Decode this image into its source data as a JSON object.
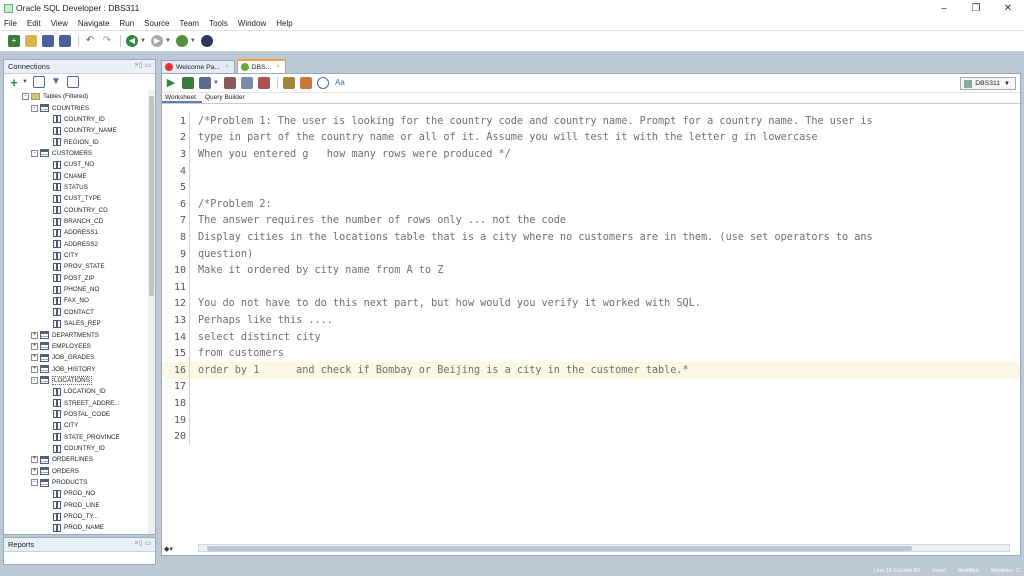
{
  "window": {
    "title": "Oracle SQL Developer : DBS311"
  },
  "menu": [
    "File",
    "Edit",
    "View",
    "Navigate",
    "Run",
    "Source",
    "Team",
    "Tools",
    "Window",
    "Help"
  ],
  "connections_panel": {
    "title": "Connections"
  },
  "tree": [
    {
      "label": "Tables (Filtered)",
      "kind": "folder",
      "level": 0,
      "expander": "-"
    },
    {
      "label": "COUNTRIES",
      "kind": "table",
      "level": 1,
      "expander": "-"
    },
    {
      "label": "COUNTRY_ID",
      "kind": "column",
      "level": 2
    },
    {
      "label": "COUNTRY_NAME",
      "kind": "column",
      "level": 2
    },
    {
      "label": "REGION_ID",
      "kind": "column",
      "level": 2
    },
    {
      "label": "CUSTOMERS",
      "kind": "table",
      "level": 1,
      "expander": "-"
    },
    {
      "label": "CUST_NO",
      "kind": "column",
      "level": 2
    },
    {
      "label": "CNAME",
      "kind": "column",
      "level": 2
    },
    {
      "label": "STATUS",
      "kind": "column",
      "level": 2
    },
    {
      "label": "CUST_TYPE",
      "kind": "column",
      "level": 2
    },
    {
      "label": "COUNTRY_CD",
      "kind": "column",
      "level": 2
    },
    {
      "label": "BRANCH_CD",
      "kind": "column",
      "level": 2
    },
    {
      "label": "ADDRESS1",
      "kind": "column",
      "level": 2
    },
    {
      "label": "ADDRESS2",
      "kind": "column",
      "level": 2
    },
    {
      "label": "CITY",
      "kind": "column",
      "level": 2
    },
    {
      "label": "PROV_STATE",
      "kind": "column",
      "level": 2
    },
    {
      "label": "POST_ZIP",
      "kind": "column",
      "level": 2
    },
    {
      "label": "PHONE_NO",
      "kind": "column",
      "level": 2
    },
    {
      "label": "FAX_NO",
      "kind": "column",
      "level": 2
    },
    {
      "label": "CONTACT",
      "kind": "column",
      "level": 2
    },
    {
      "label": "SALES_REP",
      "kind": "column",
      "level": 2
    },
    {
      "label": "DEPARTMENTS",
      "kind": "table",
      "level": 1,
      "expander": "+"
    },
    {
      "label": "EMPLOYEES",
      "kind": "table",
      "level": 1,
      "expander": "+"
    },
    {
      "label": "JOB_GRADES",
      "kind": "table",
      "level": 1,
      "expander": "+"
    },
    {
      "label": "JOB_HISTORY",
      "kind": "table",
      "level": 1,
      "expander": "+"
    },
    {
      "label": "LOCATIONS",
      "kind": "table",
      "level": 1,
      "expander": "-",
      "selected": true
    },
    {
      "label": "LOCATION_ID",
      "kind": "column",
      "level": 2
    },
    {
      "label": "STREET_ADDRE...",
      "kind": "column",
      "level": 2
    },
    {
      "label": "POSTAL_CODE",
      "kind": "column",
      "level": 2
    },
    {
      "label": "CITY",
      "kind": "column",
      "level": 2
    },
    {
      "label": "STATE_PROVINCE",
      "kind": "column",
      "level": 2
    },
    {
      "label": "COUNTRY_ID",
      "kind": "column",
      "level": 2
    },
    {
      "label": "ORDERLINES",
      "kind": "table",
      "level": 1,
      "expander": "+"
    },
    {
      "label": "ORDERS",
      "kind": "table",
      "level": 1,
      "expander": "+"
    },
    {
      "label": "PRODUCTS",
      "kind": "table",
      "level": 1,
      "expander": "-"
    },
    {
      "label": "PROD_NO",
      "kind": "column",
      "level": 2
    },
    {
      "label": "PROD_LINE",
      "kind": "column",
      "level": 2
    },
    {
      "label": "PROD_TY...",
      "kind": "column",
      "level": 2
    },
    {
      "label": "PROD_NAME",
      "kind": "column",
      "level": 2
    }
  ],
  "reports_panel": {
    "title": "Reports"
  },
  "editor_tabs": [
    {
      "label": "Welcome Pa...",
      "active": false,
      "icon_color": "#d33"
    },
    {
      "label": "DBS...",
      "active": true,
      "icon_color": "#6a4"
    }
  ],
  "connection_selector": {
    "value": "DBS311"
  },
  "subtabs": [
    "Worksheet",
    "Query Builder"
  ],
  "code_lines": [
    "/*Problem 1: The user is looking for the country code and country name. Prompt for a country name. The user is",
    "type in part of the country name or all of it. Assume you will test it with the letter g in lowercase",
    "When you entered g   how many rows were produced */",
    "",
    "",
    "/*Problem 2:",
    "The answer requires the number of rows only ... not the code",
    "Display cities in the locations table that is a city where no customers are in them. (use set operators to ans",
    "question)",
    "Make it ordered by city name from A to Z",
    "",
    "You do not have to do this next part, but how would you verify it worked with SQL.",
    "Perhaps like this ....",
    "select distinct city",
    "from customers",
    "order by 1      and check if Bombay or Beijing is a city in the customer table.*",
    "",
    "",
    "",
    ""
  ],
  "current_line": 16,
  "code_corner": "◆▾",
  "status": {
    "position": "Line 16 Column 82",
    "mode": "Insert",
    "state": "Modified",
    "eol": "Windows: C"
  },
  "colors": {
    "workspace": "#bcc8d5",
    "active_tab_accent": "#e8a33b",
    "current_line_bg": "#fdf8e4"
  }
}
